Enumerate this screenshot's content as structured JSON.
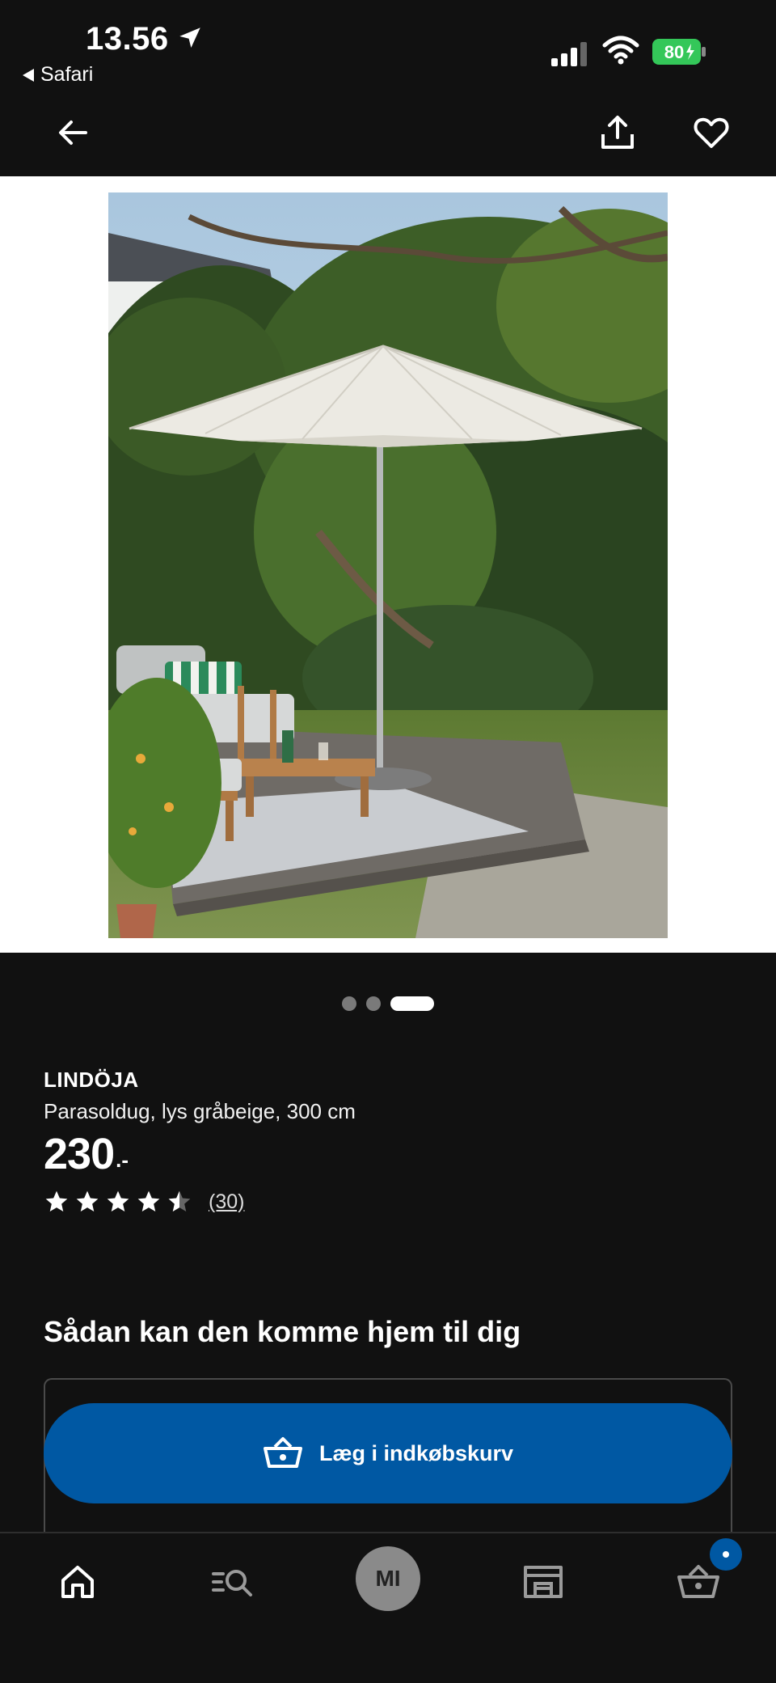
{
  "status_bar": {
    "time": "13.56",
    "back_app": "Safari",
    "battery": "80"
  },
  "product": {
    "brand": "LINDÖJA",
    "description": "Parasoldug, lys gråbeige, 300 cm",
    "price": "230",
    "price_suffix": ".-",
    "rating": 4.5,
    "review_count": "(30)"
  },
  "gallery": {
    "image_count": 3,
    "active_index": 2
  },
  "delivery": {
    "title": "Sådan kan den komme hjem til dig",
    "add_to_cart_label": "Læg i indkøbskurv"
  },
  "tab_bar": {
    "profile_initials": "MI",
    "icons": [
      "home-icon",
      "search-icon",
      "profile-avatar",
      "store-icon",
      "basket-icon"
    ]
  },
  "colors": {
    "background": "#111111",
    "accent_blue": "#0058a3",
    "battery_green": "#34c759"
  }
}
